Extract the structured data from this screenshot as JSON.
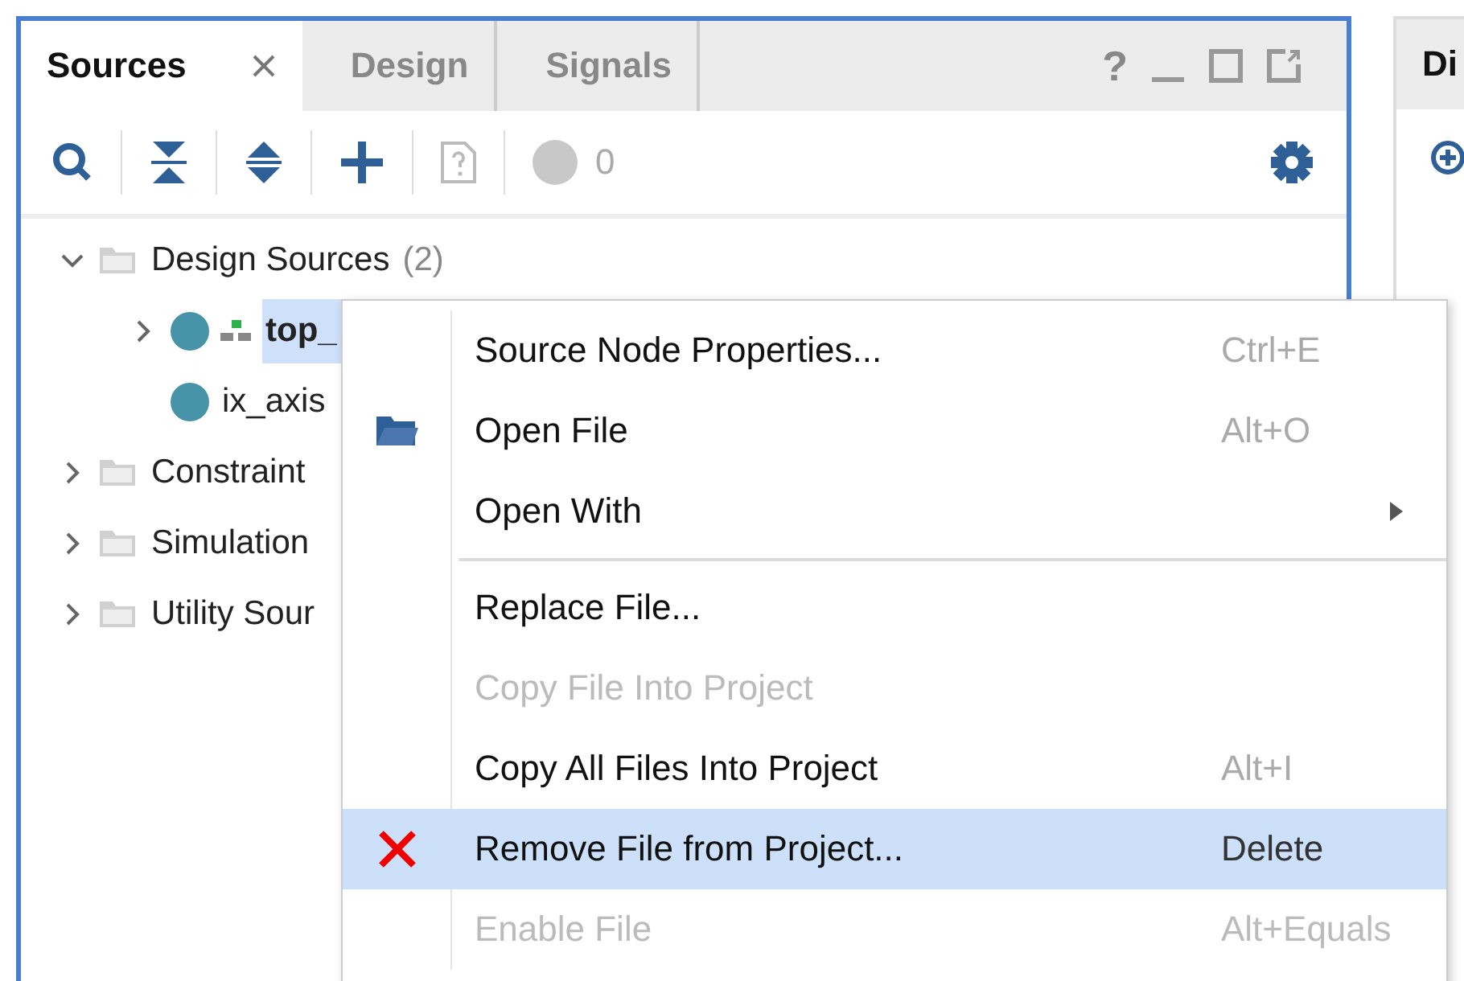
{
  "panel": {
    "tabs": [
      {
        "label": "Sources",
        "selected": true,
        "closable": true
      },
      {
        "label": "Design",
        "selected": false,
        "closable": false
      },
      {
        "label": "Signals",
        "selected": false,
        "closable": false
      }
    ],
    "help": "?",
    "toolbar": {
      "warning_count": "0"
    },
    "tree": [
      {
        "label": "Design Sources",
        "count": "(2)",
        "kind": "folder",
        "expanded": true,
        "selected": false,
        "children": [
          {
            "label": "top_",
            "kind": "module",
            "expanded": false,
            "selected": true
          },
          {
            "label": "ix_axis",
            "kind": "file",
            "selected": false
          }
        ]
      },
      {
        "label": "Constraint",
        "kind": "folder",
        "expanded": false,
        "selected": false
      },
      {
        "label": "Simulation",
        "kind": "folder",
        "expanded": false,
        "selected": false
      },
      {
        "label": "Utility Sour",
        "kind": "folder",
        "expanded": false,
        "selected": false
      }
    ]
  },
  "side_panel": {
    "title": "Di"
  },
  "context_menu": [
    {
      "kind": "plain",
      "label": "Source Node Properties...",
      "shortcut": "Ctrl+E",
      "disabled": false,
      "selected": false,
      "submenu": false
    },
    {
      "kind": "folder",
      "label": "Open File",
      "shortcut": "Alt+O",
      "disabled": false,
      "selected": false,
      "submenu": false
    },
    {
      "kind": "plain",
      "label": "Open With",
      "disabled": false,
      "selected": false,
      "submenu": true
    },
    {
      "kind": "separator"
    },
    {
      "kind": "plain",
      "label": "Replace File...",
      "disabled": false,
      "selected": false,
      "submenu": false
    },
    {
      "kind": "plain",
      "label": "Copy File Into Project",
      "disabled": true,
      "selected": false,
      "submenu": false
    },
    {
      "kind": "plain",
      "label": "Copy All Files Into Project",
      "shortcut": "Alt+I",
      "disabled": false,
      "selected": false,
      "submenu": false
    },
    {
      "kind": "remove",
      "label": "Remove File from Project...",
      "shortcut": "Delete",
      "disabled": false,
      "selected": true,
      "submenu": false
    },
    {
      "kind": "plain",
      "label": "Enable File",
      "shortcut": "Alt+Equals",
      "disabled": true,
      "selected": false,
      "submenu": false
    }
  ]
}
